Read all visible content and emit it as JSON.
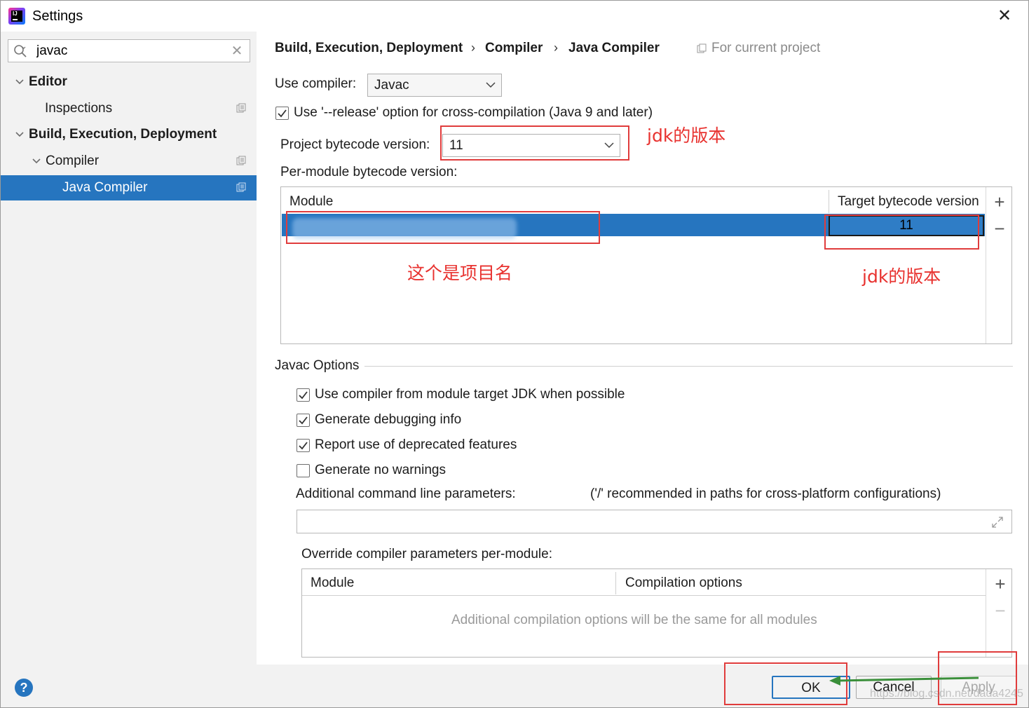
{
  "window": {
    "title": "Settings",
    "app_icon_text": "IJ"
  },
  "sidebar": {
    "search": {
      "value": "javac",
      "placeholder": ""
    },
    "items": [
      {
        "label": "Editor",
        "expanded": true,
        "bold": true
      },
      {
        "label": "Inspections"
      },
      {
        "label": "Build, Execution, Deployment",
        "expanded": true,
        "bold": true
      },
      {
        "label": "Compiler",
        "expanded": true
      },
      {
        "label": "Java Compiler",
        "selected": true
      }
    ]
  },
  "breadcrumb": {
    "items": [
      "Build, Execution, Deployment",
      "Compiler",
      "Java Compiler"
    ],
    "separator": "›",
    "scope": "For current project"
  },
  "compiler": {
    "use_compiler_label": "Use compiler:",
    "use_compiler_value": "Javac",
    "release_option": {
      "label": "Use '--release' option for cross-compilation (Java 9 and later)",
      "checked": true
    },
    "project_bytecode_label": "Project bytecode version:",
    "project_bytecode_value": "11",
    "per_module_label": "Per-module bytecode version:",
    "module_table": {
      "headers": [
        "Module",
        "Target bytecode version"
      ],
      "rows": [
        {
          "module": "",
          "target": "11",
          "selected": true
        }
      ]
    }
  },
  "javac_options": {
    "group_label": "Javac Options",
    "checkboxes": [
      {
        "label": "Use compiler from module target JDK when possible",
        "checked": true
      },
      {
        "label": "Generate debugging info",
        "checked": true
      },
      {
        "label": "Report use of deprecated features",
        "checked": true
      },
      {
        "label": "Generate no warnings",
        "checked": false
      }
    ],
    "additional_params_label": "Additional command line parameters:",
    "additional_params_hint": "('/' recommended in paths for cross-platform configurations)",
    "additional_params_value": "",
    "override_label": "Override compiler parameters per-module:",
    "override_table": {
      "headers": [
        "Module",
        "Compilation options"
      ],
      "empty_text": "Additional compilation options will be the same for all modules"
    }
  },
  "annotations": {
    "jdk_version_1": "jdk的版本",
    "project_name": "这个是项目名",
    "jdk_version_2": "jdk的版本",
    "color": "#e8322f"
  },
  "buttons": {
    "ok": "OK",
    "cancel": "Cancel",
    "apply": "Apply",
    "help": "?"
  },
  "watermark": "https://blog.csdn.net/dada4245",
  "colors": {
    "selection": "#2675bf",
    "sidebar_bg": "#f2f2f2",
    "annotation_red": "#e03c3c",
    "arrow_green": "#3a8f3a"
  }
}
